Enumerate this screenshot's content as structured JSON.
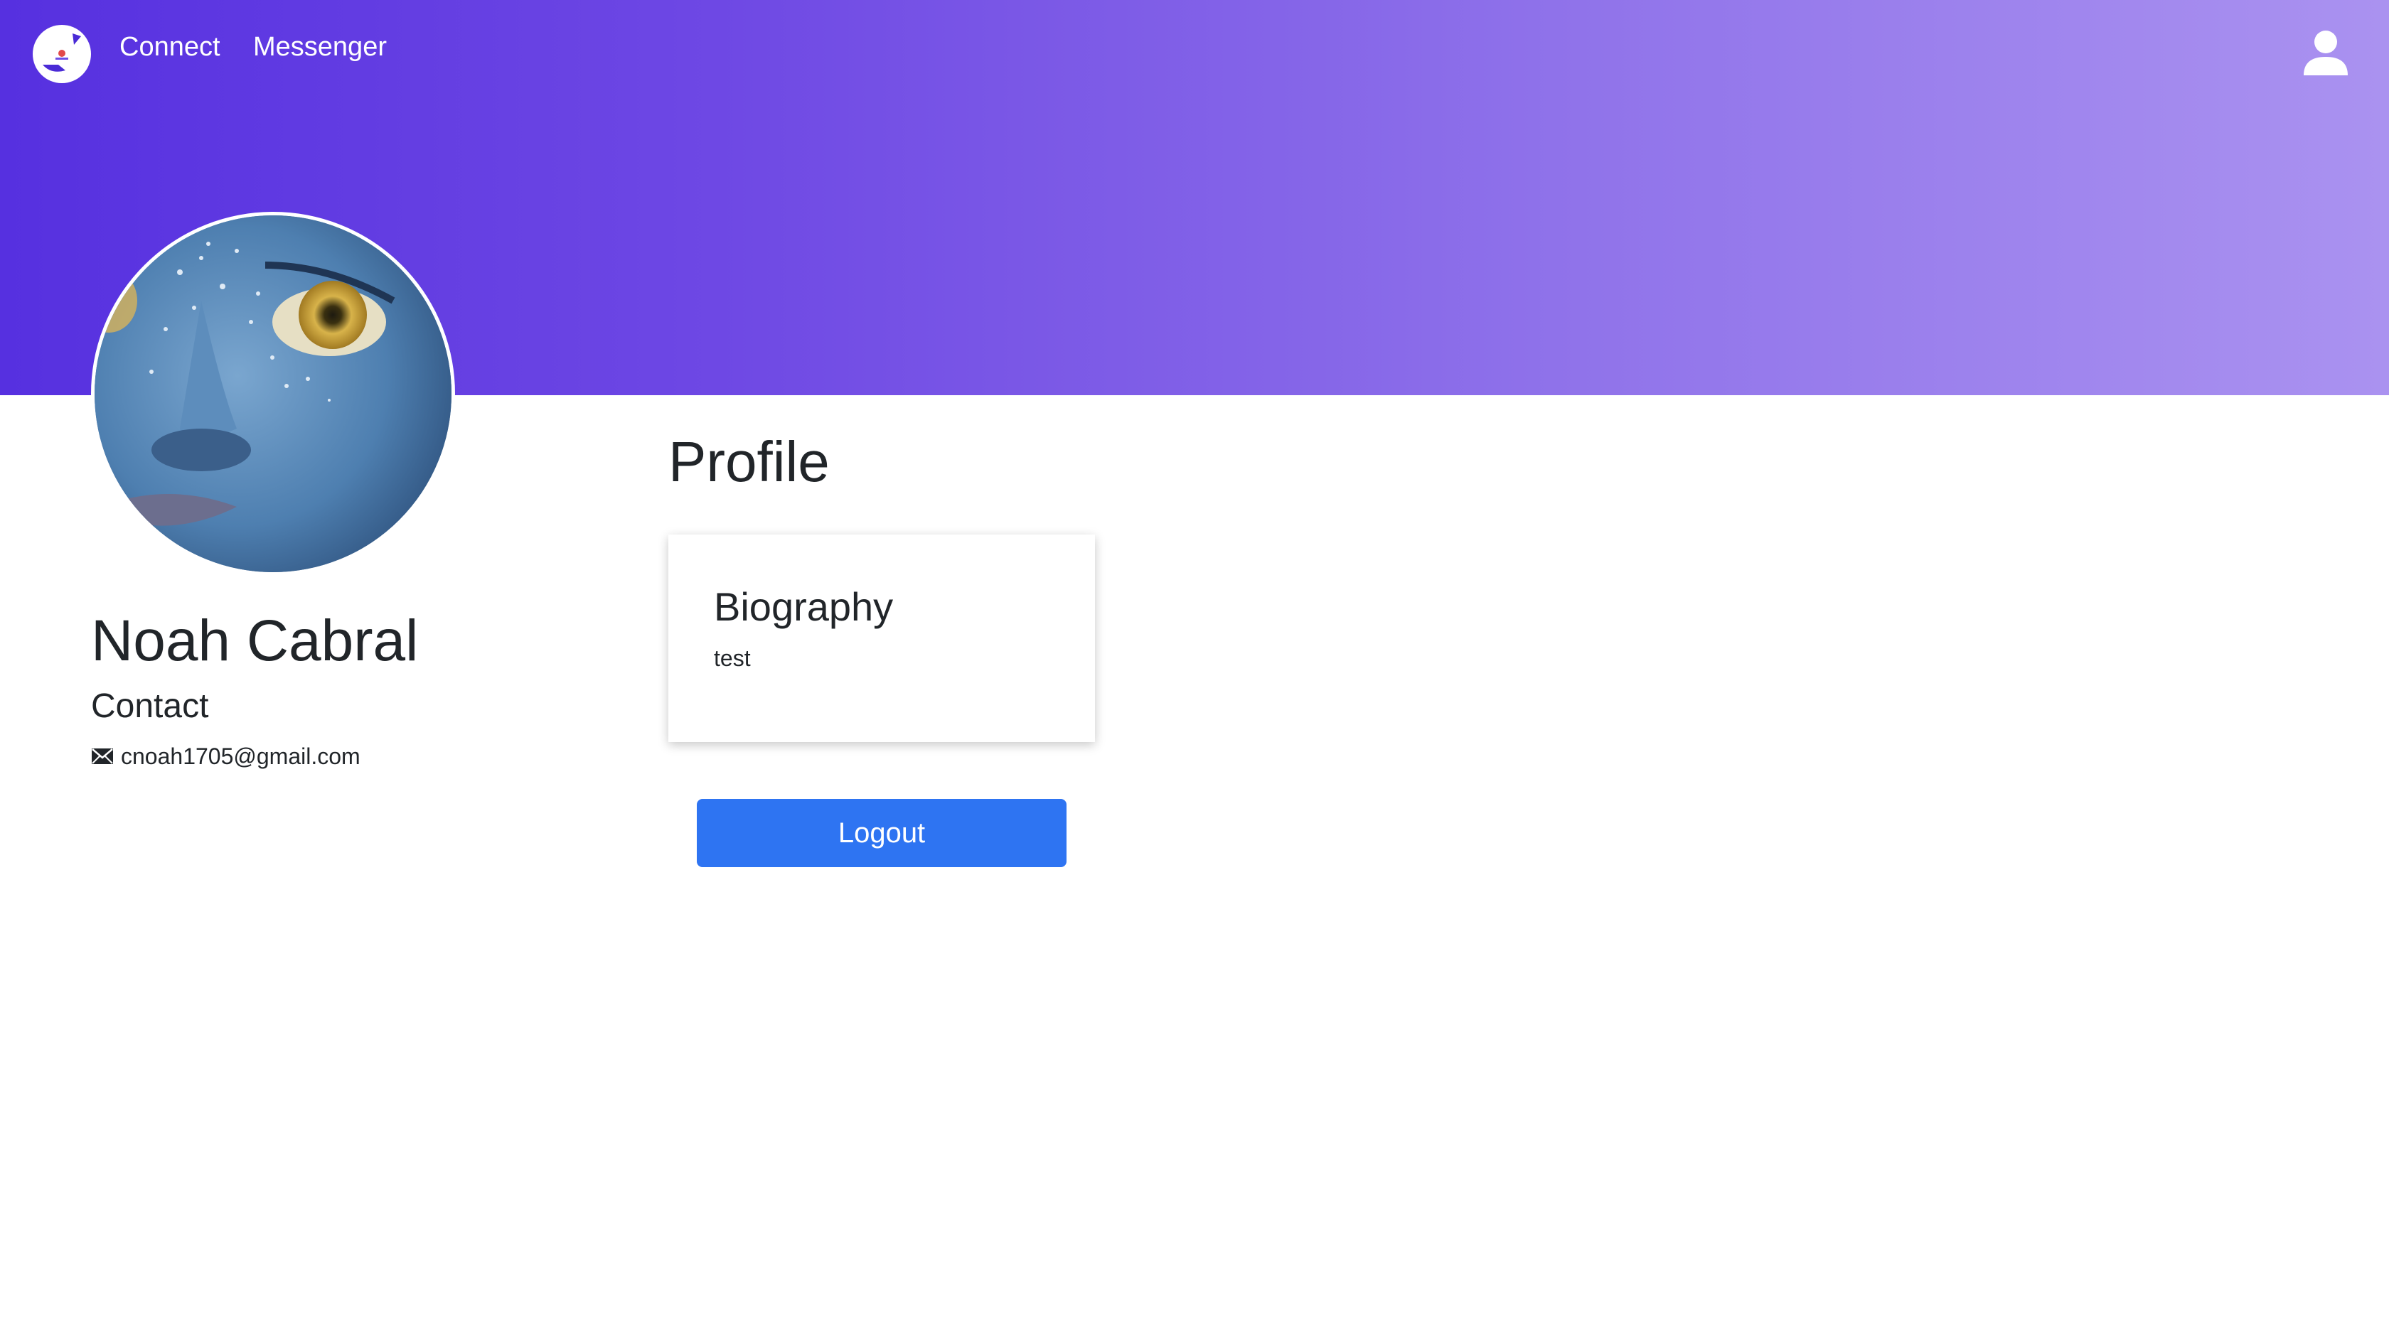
{
  "nav": {
    "links": [
      {
        "label": "Connect"
      },
      {
        "label": "Messenger"
      }
    ],
    "logo_icon": "app-logo-icon",
    "user_icon": "user-icon"
  },
  "profile": {
    "name": "Noah Cabral",
    "contact_heading": "Contact",
    "email": "cnoah1705@gmail.com",
    "email_icon": "envelope-icon"
  },
  "main": {
    "title": "Profile",
    "biography": {
      "heading": "Biography",
      "text": "test"
    },
    "logout_label": "Logout"
  },
  "colors": {
    "banner_start": "#5630e0",
    "banner_end": "#aa92f0",
    "button_primary": "#2e74f2"
  }
}
